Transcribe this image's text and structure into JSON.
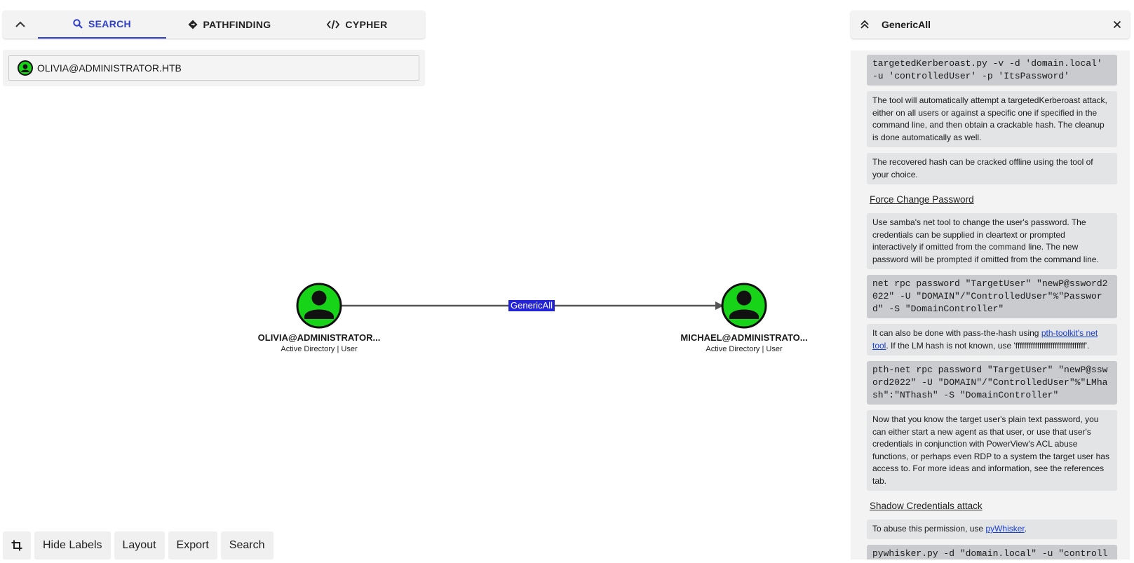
{
  "tabs": {
    "search": "SEARCH",
    "pathfinding": "PATHFINDING",
    "cypher": "CYPHER"
  },
  "search": {
    "value": "OLIVIA@ADMINISTRATOR.HTB"
  },
  "graph": {
    "source": {
      "label": "OLIVIA@ADMINISTRATOR...",
      "sub": "Active Directory | User"
    },
    "target": {
      "label": "MICHAEL@ADMINISTRATO...",
      "sub": "Active Directory | User"
    },
    "edge_label": "GenericAll",
    "node_color": "#18d418",
    "edge_label_color": "#2323d8"
  },
  "toolbar": {
    "hide_labels": "Hide Labels",
    "layout": "Layout",
    "export": "Export",
    "search": "Search"
  },
  "panel": {
    "title": "GenericAll",
    "code1": "targetedKerberoast.py -v -d 'domain.local' -u 'controlledUser' -p 'ItsPassword'",
    "p1": "The tool will automatically attempt a targetedKerberoast attack, either on all users or against a specific one if specified in the command line, and then obtain a crackable hash. The cleanup is done automatically as well.",
    "p2": "The recovered hash can be cracked offline using the tool of your choice.",
    "section1": "Force Change Password",
    "p3": "Use samba's net tool to change the user's password. The credentials can be supplied in cleartext or prompted interactively if omitted from the command line. The new password will be prompted if omitted from the command line.",
    "code2": "net rpc password \"TargetUser\" \"newP@ssword2022\" -U \"DOMAIN\"/\"ControlledUser\"%\"Password\" -S \"DomainController\"",
    "p4_pre": "It can also be done with pass-the-hash using ",
    "p4_link": "pth-toolkit's net tool",
    "p4_post": ". If the LM hash is not known, use 'ffffffffffffffffffffffffffffffff'.",
    "code3": "pth-net rpc password \"TargetUser\" \"newP@ssword2022\" -U \"DOMAIN\"/\"ControlledUser\"%\"LMhash\":\"NThash\" -S \"DomainController\"",
    "p5": "Now that you know the target user's plain text password, you can either start a new agent as that user, or use that user's credentials in conjunction with PowerView's ACL abuse functions, or perhaps even RDP to a system the target user has access to. For more ideas and information, see the references tab.",
    "section2": "Shadow Credentials attack",
    "p6_pre": "To abuse this permission, use ",
    "p6_link": "pyWhisker",
    "p6_post": ".",
    "code4": "pywhisker.py -d \"domain.local\" -u \"controlledAccount\" -p \"somepassword\" --target \"targetAccount\""
  }
}
